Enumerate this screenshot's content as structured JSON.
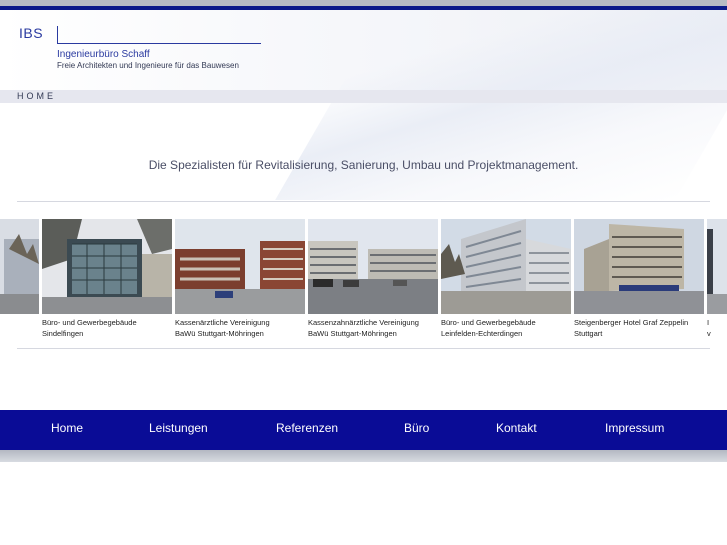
{
  "header": {
    "logo": "IBS",
    "company": "Ingenieurbüro Schaff",
    "tagline": "Freie Architekten und Ingenieure für das Bauwesen"
  },
  "breadcrumb": "HOME",
  "slogan": "Die Spezialisten für Revitalisierung, Sanierung, Umbau und Projektmanagement.",
  "projects": [
    {
      "line1": "",
      "line2": ""
    },
    {
      "line1": "Büro- und Gewerbegebäude",
      "line2": "Sindelfingen"
    },
    {
      "line1": "Kassenärztliche Vereinigung",
      "line2": "BaWü Stuttgart-Möhringen"
    },
    {
      "line1": "Kassenzahnärztliche Vereinigung",
      "line2": "BaWü Stuttgart-Möhringen"
    },
    {
      "line1": "Büro- und Gewerbegebäude",
      "line2": "Leinfelden-Echterdingen"
    },
    {
      "line1": "Steigenberger Hotel Graf Zeppelin",
      "line2": "Stuttgart"
    },
    {
      "line1": "I",
      "line2": "v"
    }
  ],
  "nav": [
    {
      "label": "Home"
    },
    {
      "label": "Leistungen"
    },
    {
      "label": "Referenzen"
    },
    {
      "label": "Büro"
    },
    {
      "label": "Kontakt"
    },
    {
      "label": "Impressum"
    }
  ],
  "colors": {
    "brand": "#0a0c96",
    "accent": "#2a3aa0"
  }
}
